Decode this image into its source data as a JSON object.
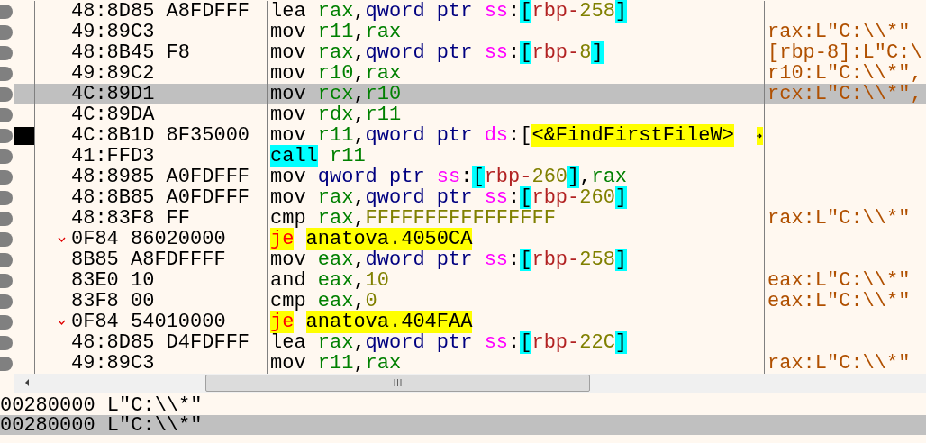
{
  "rows": [
    {
      "bytes": "48:8D85 A8FDFFF",
      "jump": false,
      "selected": false,
      "current": false,
      "instruction": [
        {
          "text": "lea",
          "kind": "mnem"
        },
        {
          "text": "rax",
          "kind": "reg",
          "space_before": true
        },
        {
          "text": ",",
          "kind": "punct"
        },
        {
          "text": "qword ptr",
          "kind": "size"
        },
        {
          "text": "ss",
          "kind": "seg",
          "space_before": true
        },
        {
          "text": ":",
          "kind": "punct"
        },
        {
          "text": "[",
          "kind": "bracket"
        },
        {
          "text": "rbp-",
          "kind": "mem"
        },
        {
          "text": "258",
          "kind": "num"
        },
        {
          "text": "]",
          "kind": "bracket"
        }
      ]
    },
    {
      "bytes": "49:89C3",
      "jump": false,
      "selected": false,
      "current": false,
      "comment": "rax:L\"C:\\\\*\"",
      "instruction": [
        {
          "text": "mov",
          "kind": "mnem"
        },
        {
          "text": "r11",
          "kind": "reg",
          "space_before": true
        },
        {
          "text": ",",
          "kind": "punct"
        },
        {
          "text": "rax",
          "kind": "reg"
        }
      ]
    },
    {
      "bytes": "48:8B45 F8",
      "jump": false,
      "selected": false,
      "current": false,
      "comment": "[rbp-8]:L\"C:\\",
      "instruction": [
        {
          "text": "mov",
          "kind": "mnem"
        },
        {
          "text": "rax",
          "kind": "reg",
          "space_before": true
        },
        {
          "text": ",",
          "kind": "punct"
        },
        {
          "text": "qword ptr",
          "kind": "size"
        },
        {
          "text": "ss",
          "kind": "seg",
          "space_before": true
        },
        {
          "text": ":",
          "kind": "punct"
        },
        {
          "text": "[",
          "kind": "bracket"
        },
        {
          "text": "rbp-",
          "kind": "mem"
        },
        {
          "text": "8",
          "kind": "num"
        },
        {
          "text": "]",
          "kind": "bracket"
        }
      ]
    },
    {
      "bytes": "49:89C2",
      "jump": false,
      "selected": false,
      "current": false,
      "comment": "r10:L\"C:\\\\*\",",
      "instruction": [
        {
          "text": "mov",
          "kind": "mnem"
        },
        {
          "text": "r10",
          "kind": "reg",
          "space_before": true
        },
        {
          "text": ",",
          "kind": "punct"
        },
        {
          "text": "rax",
          "kind": "reg"
        }
      ]
    },
    {
      "bytes": "4C:89D1",
      "jump": false,
      "selected": true,
      "current": false,
      "comment": "rcx:L\"C:\\\\*\",",
      "instruction": [
        {
          "text": "mov",
          "kind": "mnem"
        },
        {
          "text": "rcx",
          "kind": "reg",
          "space_before": true
        },
        {
          "text": ",",
          "kind": "punct"
        },
        {
          "text": "r10",
          "kind": "reg"
        }
      ]
    },
    {
      "bytes": "4C:89DA",
      "jump": false,
      "selected": false,
      "current": false,
      "instruction": [
        {
          "text": "mov",
          "kind": "mnem"
        },
        {
          "text": "rdx",
          "kind": "reg",
          "space_before": true
        },
        {
          "text": ",",
          "kind": "punct"
        },
        {
          "text": "r11",
          "kind": "reg"
        }
      ]
    },
    {
      "bytes": "4C:8B1D 8F35000",
      "jump": false,
      "selected": false,
      "current": true,
      "instruction": [
        {
          "text": "mov",
          "kind": "mnem"
        },
        {
          "text": "r11",
          "kind": "reg",
          "space_before": true
        },
        {
          "text": ",",
          "kind": "punct"
        },
        {
          "text": "qword ptr",
          "kind": "size"
        },
        {
          "text": "ds",
          "kind": "seg",
          "space_before": true
        },
        {
          "text": ":",
          "kind": "punct"
        },
        {
          "text": "[",
          "kind": "punct"
        },
        {
          "text": "<&FindFirstFileW>",
          "kind": "label"
        }
      ]
    },
    {
      "bytes": "41:FFD3",
      "jump": false,
      "selected": false,
      "current": false,
      "instruction": [
        {
          "text": "call",
          "kind": "call"
        },
        {
          "text": "r11",
          "kind": "reg",
          "space_before": true
        }
      ]
    },
    {
      "bytes": "48:8985 A0FDFFF",
      "jump": false,
      "selected": false,
      "current": false,
      "instruction": [
        {
          "text": "mov",
          "kind": "mnem"
        },
        {
          "text": "qword ptr",
          "kind": "size",
          "space_before": true
        },
        {
          "text": "ss",
          "kind": "seg",
          "space_before": true
        },
        {
          "text": ":",
          "kind": "punct"
        },
        {
          "text": "[",
          "kind": "bracket"
        },
        {
          "text": "rbp-",
          "kind": "mem"
        },
        {
          "text": "260",
          "kind": "num"
        },
        {
          "text": "]",
          "kind": "bracket"
        },
        {
          "text": ",",
          "kind": "punct"
        },
        {
          "text": "rax",
          "kind": "reg"
        }
      ]
    },
    {
      "bytes": "48:8B85 A0FDFFF",
      "jump": false,
      "selected": false,
      "current": false,
      "instruction": [
        {
          "text": "mov",
          "kind": "mnem"
        },
        {
          "text": "rax",
          "kind": "reg",
          "space_before": true
        },
        {
          "text": ",",
          "kind": "punct"
        },
        {
          "text": "qword ptr",
          "kind": "size"
        },
        {
          "text": "ss",
          "kind": "seg",
          "space_before": true
        },
        {
          "text": ":",
          "kind": "punct"
        },
        {
          "text": "[",
          "kind": "bracket"
        },
        {
          "text": "rbp-",
          "kind": "mem"
        },
        {
          "text": "260",
          "kind": "num"
        },
        {
          "text": "]",
          "kind": "bracket"
        }
      ]
    },
    {
      "bytes": "48:83F8 FF",
      "jump": false,
      "selected": false,
      "current": false,
      "comment": "rax:L\"C:\\\\*\"",
      "instruction": [
        {
          "text": "cmp",
          "kind": "mnem"
        },
        {
          "text": "rax",
          "kind": "reg",
          "space_before": true
        },
        {
          "text": ",",
          "kind": "punct"
        },
        {
          "text": "FFFFFFFFFFFFFFFF",
          "kind": "num"
        }
      ]
    },
    {
      "bytes": "0F84 86020000",
      "jump": true,
      "selected": false,
      "current": false,
      "instruction": [
        {
          "text": "je",
          "kind": "jump"
        },
        {
          "text": "anatova.4050CA",
          "kind": "label",
          "space_before": true
        }
      ]
    },
    {
      "bytes": "8B85 A8FDFFFF",
      "jump": false,
      "selected": false,
      "current": false,
      "instruction": [
        {
          "text": "mov",
          "kind": "mnem"
        },
        {
          "text": "eax",
          "kind": "reg",
          "space_before": true
        },
        {
          "text": ",",
          "kind": "punct"
        },
        {
          "text": "dword ptr",
          "kind": "size"
        },
        {
          "text": "ss",
          "kind": "seg",
          "space_before": true
        },
        {
          "text": ":",
          "kind": "punct"
        },
        {
          "text": "[",
          "kind": "bracket"
        },
        {
          "text": "rbp-",
          "kind": "mem"
        },
        {
          "text": "258",
          "kind": "num"
        },
        {
          "text": "]",
          "kind": "bracket"
        }
      ]
    },
    {
      "bytes": "83E0 10",
      "jump": false,
      "selected": false,
      "current": false,
      "comment": "eax:L\"C:\\\\*\"",
      "instruction": [
        {
          "text": "and",
          "kind": "mnem"
        },
        {
          "text": "eax",
          "kind": "reg",
          "space_before": true
        },
        {
          "text": ",",
          "kind": "punct"
        },
        {
          "text": "10",
          "kind": "num"
        }
      ]
    },
    {
      "bytes": "83F8 00",
      "jump": false,
      "selected": false,
      "current": false,
      "comment": "eax:L\"C:\\\\*\"",
      "instruction": [
        {
          "text": "cmp",
          "kind": "mnem"
        },
        {
          "text": "eax",
          "kind": "reg",
          "space_before": true
        },
        {
          "text": ",",
          "kind": "punct"
        },
        {
          "text": "0",
          "kind": "num"
        }
      ]
    },
    {
      "bytes": "0F84 54010000",
      "jump": true,
      "selected": false,
      "current": false,
      "instruction": [
        {
          "text": "je",
          "kind": "jump"
        },
        {
          "text": "anatova.404FAA",
          "kind": "label",
          "space_before": true
        }
      ]
    },
    {
      "bytes": "48:8D85 D4FDFFF",
      "jump": false,
      "selected": false,
      "current": false,
      "instruction": [
        {
          "text": "lea",
          "kind": "mnem"
        },
        {
          "text": "rax",
          "kind": "reg",
          "space_before": true
        },
        {
          "text": ",",
          "kind": "punct"
        },
        {
          "text": "qword ptr",
          "kind": "size"
        },
        {
          "text": "ss",
          "kind": "seg",
          "space_before": true
        },
        {
          "text": ":",
          "kind": "punct"
        },
        {
          "text": "[",
          "kind": "bracket"
        },
        {
          "text": "rbp-",
          "kind": "mem"
        },
        {
          "text": "22C",
          "kind": "num"
        },
        {
          "text": "]",
          "kind": "bracket"
        }
      ]
    },
    {
      "bytes": "49:89C3",
      "jump": false,
      "selected": false,
      "current": false,
      "comment": "rax:L\"C:\\\\*\"",
      "instruction": [
        {
          "text": "mov",
          "kind": "mnem"
        },
        {
          "text": "r11",
          "kind": "reg",
          "space_before": true
        },
        {
          "text": ",",
          "kind": "punct"
        },
        {
          "text": "rax",
          "kind": "reg"
        }
      ]
    }
  ],
  "dump": [
    {
      "text": "00280000 L\"C:\\\\*\"",
      "selected": false
    },
    {
      "text": "00280000 L\"C:\\\\*\"",
      "selected": true
    }
  ]
}
